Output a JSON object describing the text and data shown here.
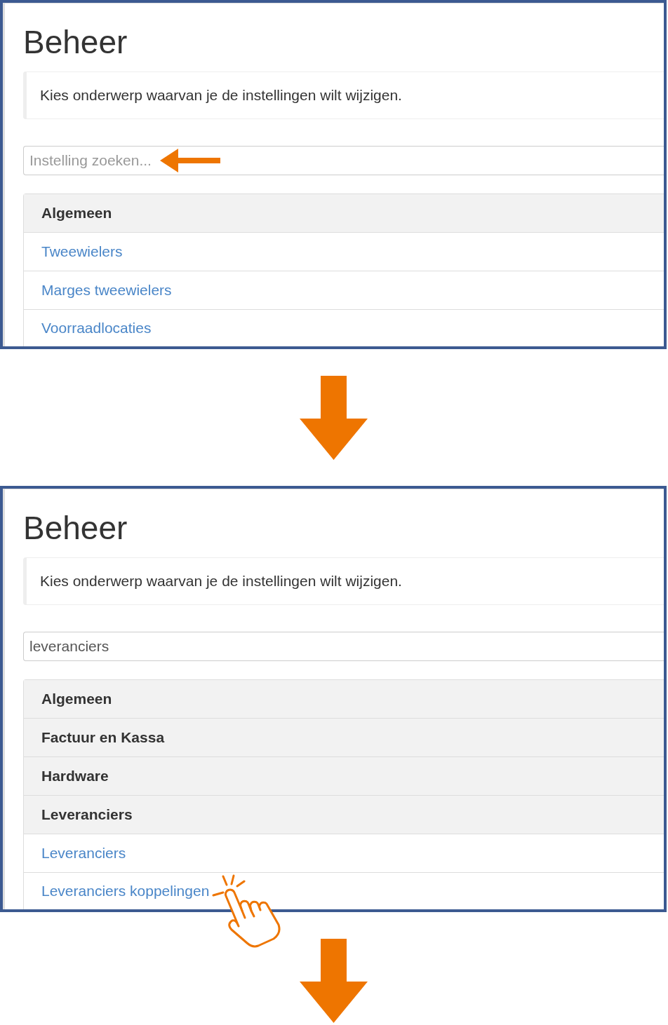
{
  "panels": [
    {
      "title": "Beheer",
      "intro": "Kies onderwerp waarvan je de instellingen wilt wijzigen.",
      "search": {
        "placeholder": "Instelling zoeken...",
        "highlighted": true
      },
      "list": [
        {
          "kind": "header",
          "label": "Algemeen",
          "tapped": false
        },
        {
          "kind": "link",
          "label": "Tweewielers",
          "tapped": false
        },
        {
          "kind": "link",
          "label": "Marges tweewielers",
          "tapped": false
        },
        {
          "kind": "link",
          "label": "Voorraadlocaties",
          "tapped": false
        }
      ]
    },
    {
      "title": "Beheer",
      "intro": "Kies onderwerp waarvan je de instellingen wilt wijzigen.",
      "search": {
        "value": "leveranciers",
        "highlighted": false
      },
      "list": [
        {
          "kind": "header",
          "label": "Algemeen",
          "tapped": false
        },
        {
          "kind": "header",
          "label": "Factuur en Kassa",
          "tapped": false
        },
        {
          "kind": "header",
          "label": "Hardware",
          "tapped": false
        },
        {
          "kind": "header",
          "label": "Leveranciers",
          "tapped": false
        },
        {
          "kind": "link",
          "label": "Leveranciers",
          "tapped": false
        },
        {
          "kind": "link",
          "label": "Leveranciers koppelingen",
          "tapped": true
        }
      ]
    }
  ]
}
